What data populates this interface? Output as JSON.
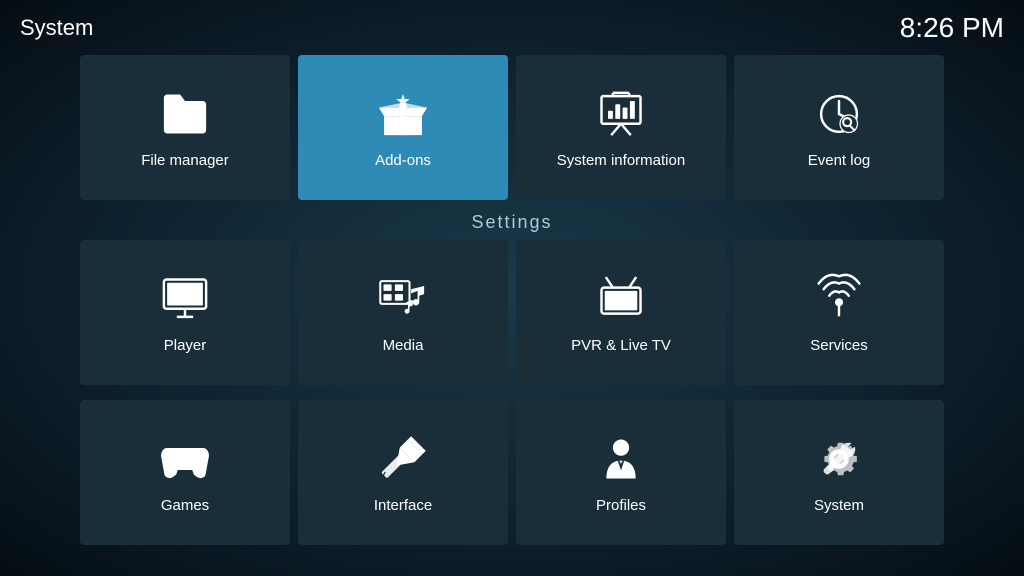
{
  "header": {
    "title": "System",
    "clock": "8:26 PM"
  },
  "top_row": [
    {
      "id": "file-manager",
      "label": "File manager",
      "icon": "folder"
    },
    {
      "id": "add-ons",
      "label": "Add-ons",
      "icon": "addons",
      "active": true
    },
    {
      "id": "system-information",
      "label": "System information",
      "icon": "sysinfo"
    },
    {
      "id": "event-log",
      "label": "Event log",
      "icon": "eventlog"
    }
  ],
  "settings_label": "Settings",
  "settings_row1": [
    {
      "id": "player",
      "label": "Player",
      "icon": "player"
    },
    {
      "id": "media",
      "label": "Media",
      "icon": "media"
    },
    {
      "id": "pvr-live-tv",
      "label": "PVR & Live TV",
      "icon": "pvr"
    },
    {
      "id": "services",
      "label": "Services",
      "icon": "services"
    }
  ],
  "settings_row2": [
    {
      "id": "games",
      "label": "Games",
      "icon": "games"
    },
    {
      "id": "interface",
      "label": "Interface",
      "icon": "interface"
    },
    {
      "id": "profiles",
      "label": "Profiles",
      "icon": "profiles"
    },
    {
      "id": "system",
      "label": "System",
      "icon": "system"
    }
  ]
}
